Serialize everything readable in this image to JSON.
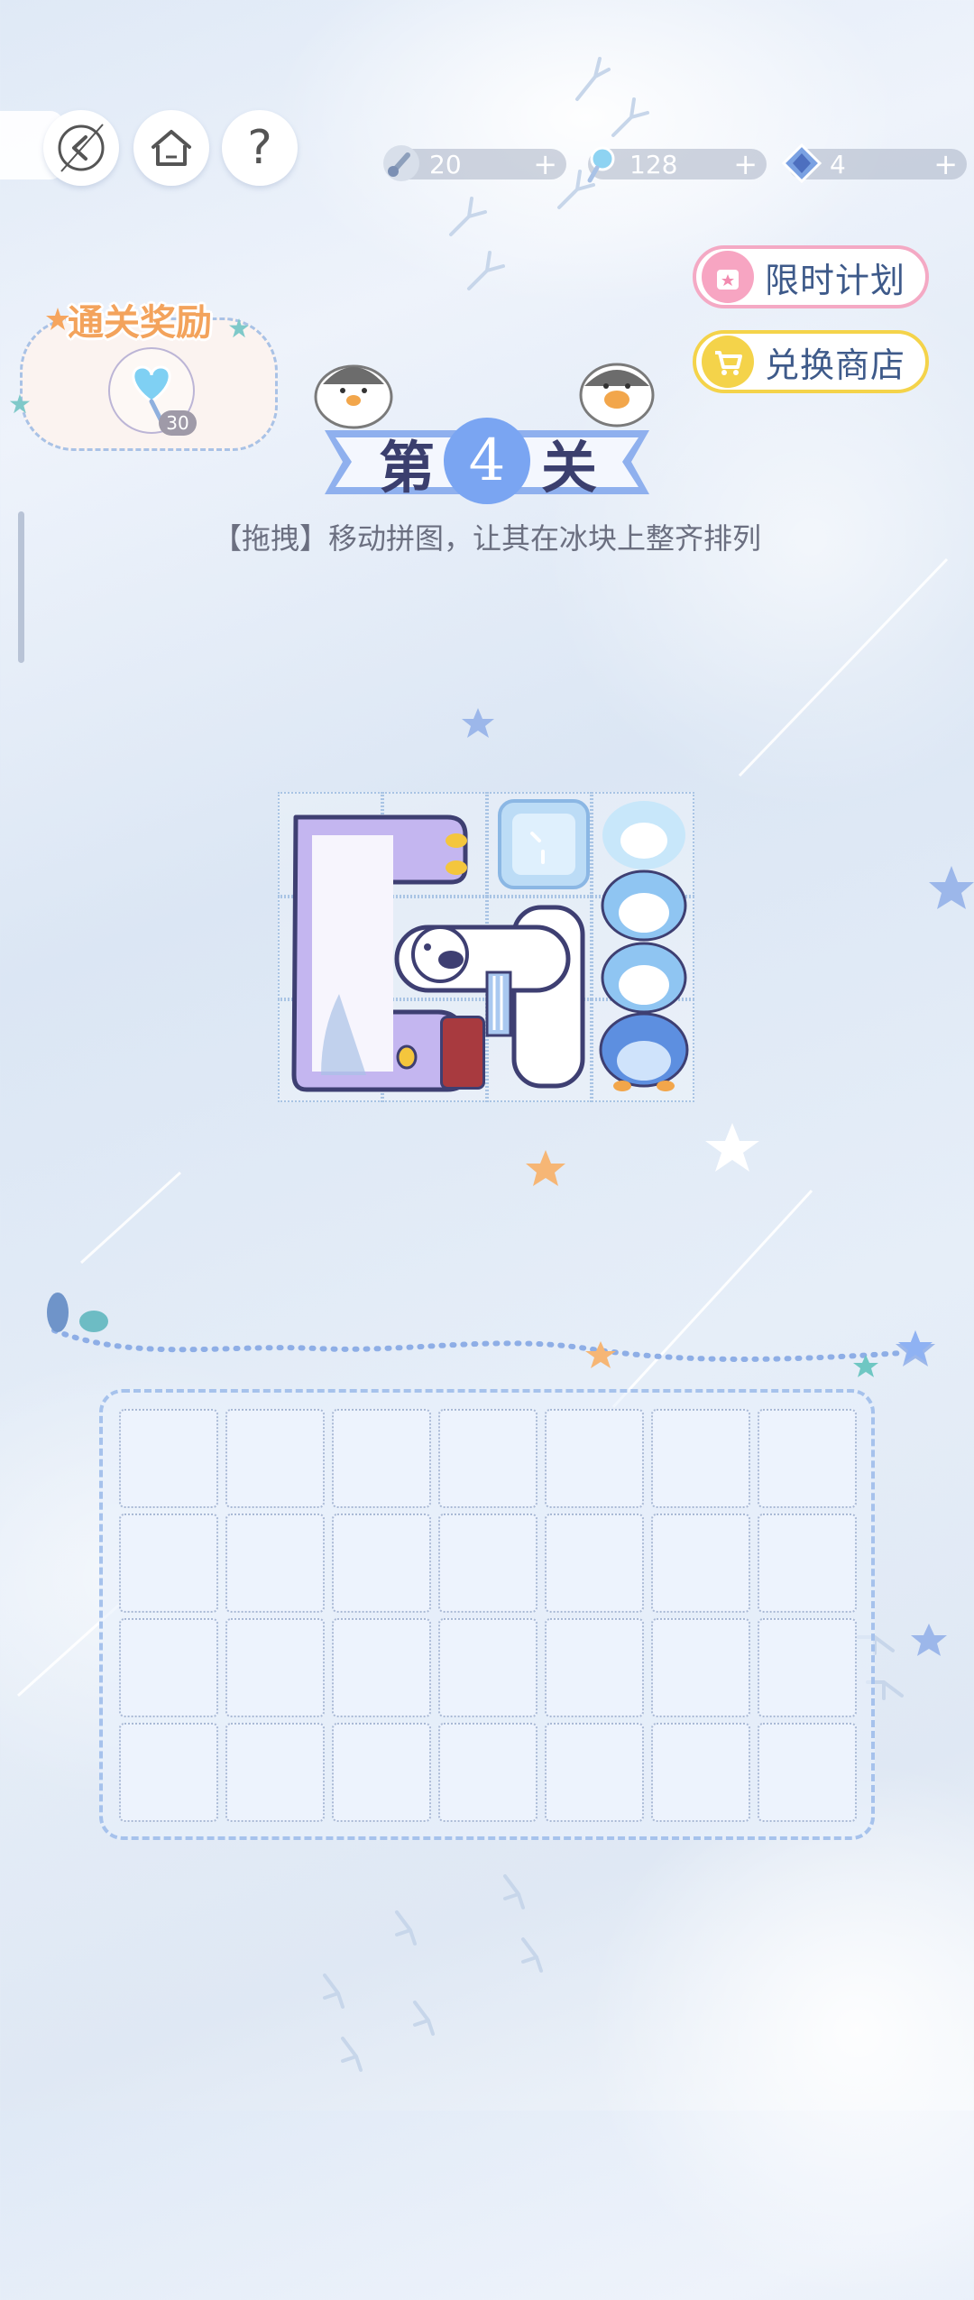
{
  "resources": [
    {
      "name": "shovel",
      "value": "20",
      "icon": "shovel-icon"
    },
    {
      "name": "candy",
      "value": "128",
      "icon": "candy-icon"
    },
    {
      "name": "diamond",
      "value": "4",
      "icon": "diamond-icon"
    }
  ],
  "buttons": {
    "limited_plan": "限时计划",
    "exchange_shop": "兑换商店"
  },
  "reward": {
    "title": "通关奖励",
    "count": "30"
  },
  "level": {
    "prefix": "第",
    "number": "4",
    "suffix": "关"
  },
  "instruction": "【拖拽】移动拼图，让其在冰块上整齐排列",
  "board": {
    "rows": 4,
    "cols": 7
  },
  "colors": {
    "accent_blue": "#7aa5f2",
    "pink": "#f28bb0",
    "yellow": "#f4d34a",
    "reward_orange": "#f3a35c"
  }
}
